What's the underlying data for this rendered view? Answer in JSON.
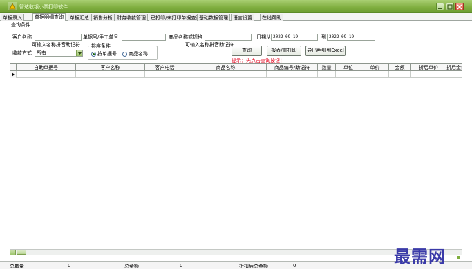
{
  "window": {
    "title": "智达收银小票打印软件"
  },
  "tabs": [
    {
      "label": "单据录入"
    },
    {
      "label": "单据明细查询"
    },
    {
      "label": "单据汇总"
    },
    {
      "label": "销售分析"
    },
    {
      "label": "财务收款管理"
    },
    {
      "label": "已打印/未打印单据查询"
    },
    {
      "label": "基础数据管理"
    },
    {
      "label": "语言设置"
    },
    {
      "label": "在线帮助"
    }
  ],
  "query": {
    "group_label": "查询条件",
    "customer_label": "客户名称",
    "customer_value": "",
    "customer_hint": "可输入名称拼音助记符",
    "doc_label": "单据号/手工单号",
    "doc_value": "",
    "product_label": "商品名称或规格",
    "product_value": "",
    "product_hint": "可输入名称拼音助记符",
    "date_from_label": "日期从",
    "date_from": "2022-09-19",
    "date_to_label": "到",
    "date_to": "2022-09-19",
    "payment_label": "收款方式",
    "payment_value": "所有",
    "sort_legend": "排序条件",
    "sort_by_doc": "按单据号",
    "sort_by_product": "商品名称",
    "query_button": "查询",
    "print_button": "报表/重打印",
    "export_button": "导出明细到Excel",
    "hint": "提示：先点击查询按钮！"
  },
  "grid": {
    "columns": [
      "自助单据号",
      "客户名称",
      "客户电话",
      "商品名称",
      "商品编号/助记符",
      "数量",
      "单位",
      "单价",
      "金额",
      "折后单价",
      "折后金额"
    ]
  },
  "status": {
    "total_qty_label": "总数量",
    "total_qty": "0",
    "total_amount_label": "总金额",
    "total_amount": "0",
    "discount_total_label": "折扣后总金额",
    "discount_total": "0"
  },
  "watermark": "最需网",
  "colors": {
    "titlebar": "#7fae3f",
    "hint": "#e2001a",
    "watermark": "#3a3aa8"
  }
}
